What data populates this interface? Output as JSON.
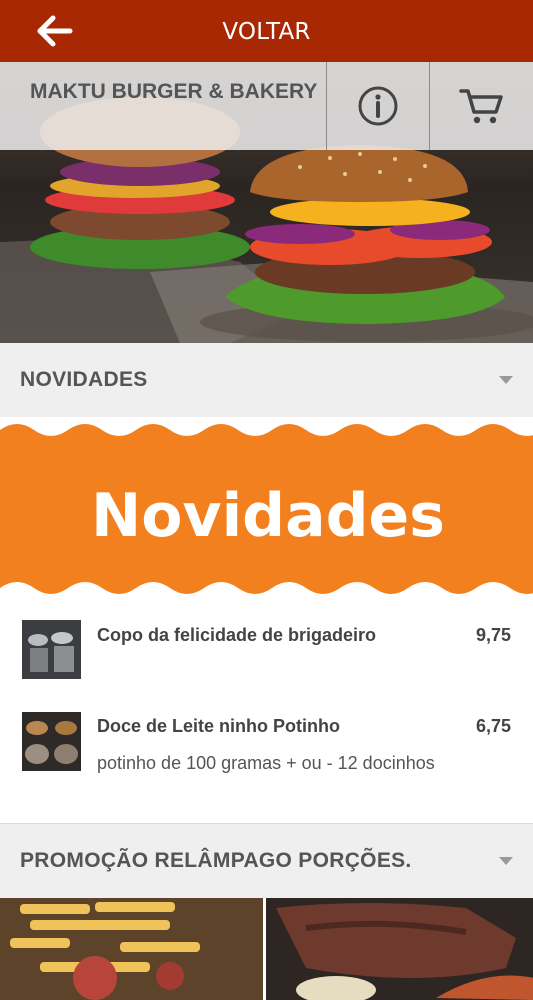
{
  "topbar": {
    "title": "VOLTAR",
    "back_icon": "arrow-left-icon"
  },
  "store": {
    "name": "MAKTU BURGER & BAKERY",
    "info_icon": "info-icon",
    "cart_icon": "cart-icon"
  },
  "sections": [
    {
      "title": "NOVIDADES",
      "banner_text": "Novidades",
      "items": [
        {
          "name": "Copo da felicidade de brigadeiro",
          "price": "9,75",
          "description": ""
        },
        {
          "name": "Doce de Leite ninho Potinho",
          "price": "6,75",
          "description": "potinho de 100 gramas + ou - 12 docinhos"
        }
      ]
    },
    {
      "title": "PROMOÇÃO RELÂMPAGO PORÇÕES."
    }
  ],
  "colors": {
    "brand": "#a82804",
    "banner_orange": "#f2801f",
    "section_bg": "#efefef"
  }
}
